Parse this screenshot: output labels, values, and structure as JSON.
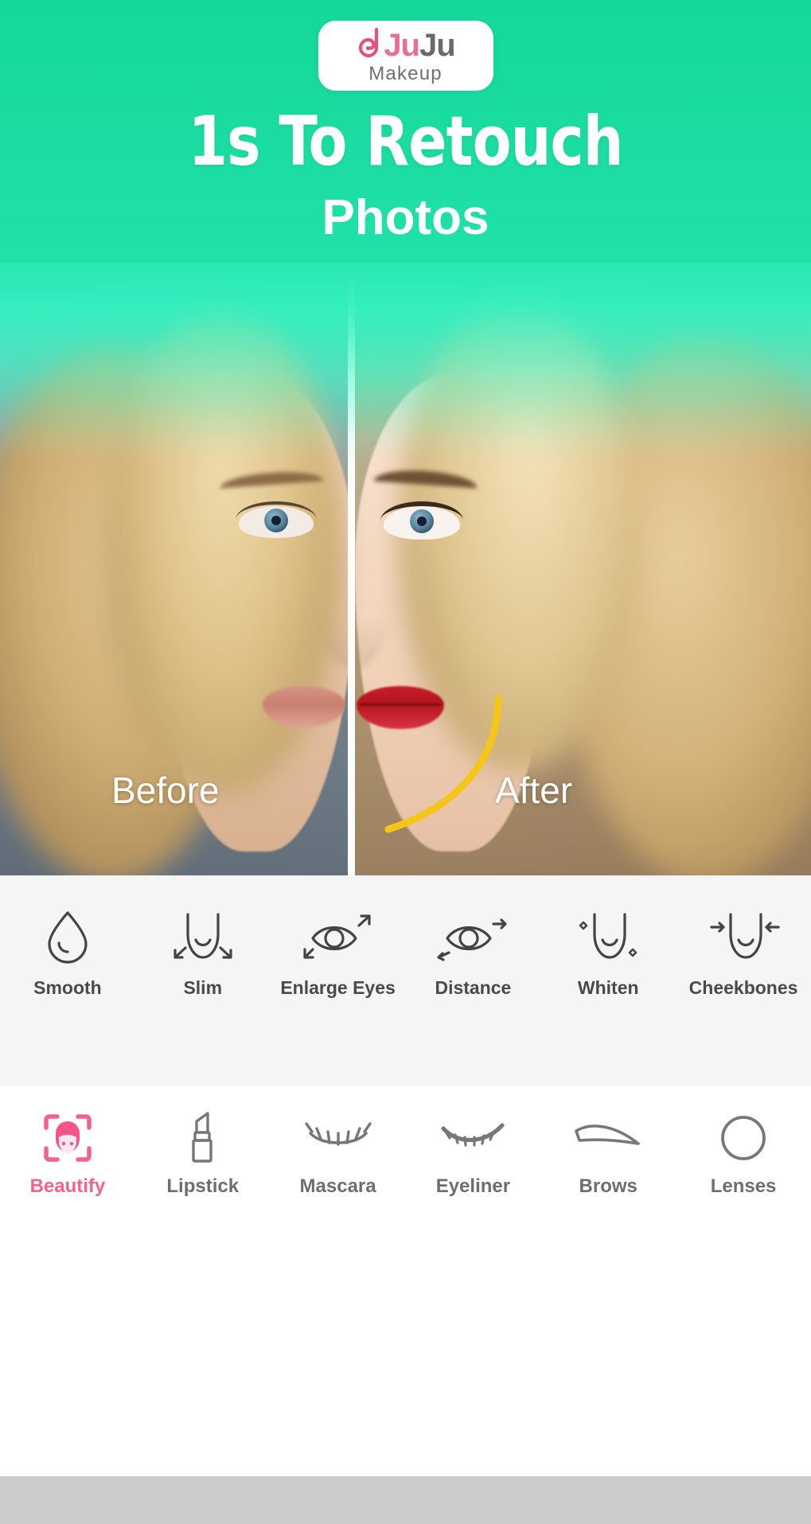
{
  "app": {
    "brand": {
      "name_part_1": "Ju",
      "name_part_2": "Ju",
      "tagline": "Makeup",
      "pink": "#ec6f91",
      "gray": "#6a6a6a"
    },
    "theme": {
      "green_top": "#14d79a",
      "green_bottom": "#49f7cb",
      "accent_pink": "#f2628d",
      "panel_bg": "#f5f5f5",
      "nav_bg": "#ffffff",
      "bottom_strip": "#cccccc",
      "contour_yellow": "#f5c518",
      "lipstick_red": "#c41f28"
    }
  },
  "hero": {
    "headline": "1s To Retouch",
    "subheadline": "Photos",
    "before_label": "Before",
    "after_label": "After"
  },
  "tools": {
    "items": [
      {
        "label": "Smooth",
        "icon": "droplet-icon"
      },
      {
        "label": "Slim",
        "icon": "face-slim-icon"
      },
      {
        "label": "Enlarge Eyes",
        "icon": "eye-enlarge-icon"
      },
      {
        "label": "Distance",
        "icon": "eye-distance-icon"
      },
      {
        "label": "Whiten",
        "icon": "face-whiten-icon"
      },
      {
        "label": "Cheekbones",
        "icon": "face-cheekbones-icon"
      }
    ]
  },
  "bottom_nav": {
    "active_index": 0,
    "items": [
      {
        "label": "Beautify",
        "icon": "face-frame-icon"
      },
      {
        "label": "Lipstick",
        "icon": "lipstick-icon"
      },
      {
        "label": "Mascara",
        "icon": "mascara-lash-icon"
      },
      {
        "label": "Eyeliner",
        "icon": "eyeliner-lash-icon"
      },
      {
        "label": "Brows",
        "icon": "eyebrow-icon"
      },
      {
        "label": "Lenses",
        "icon": "lens-circle-icon"
      }
    ]
  }
}
